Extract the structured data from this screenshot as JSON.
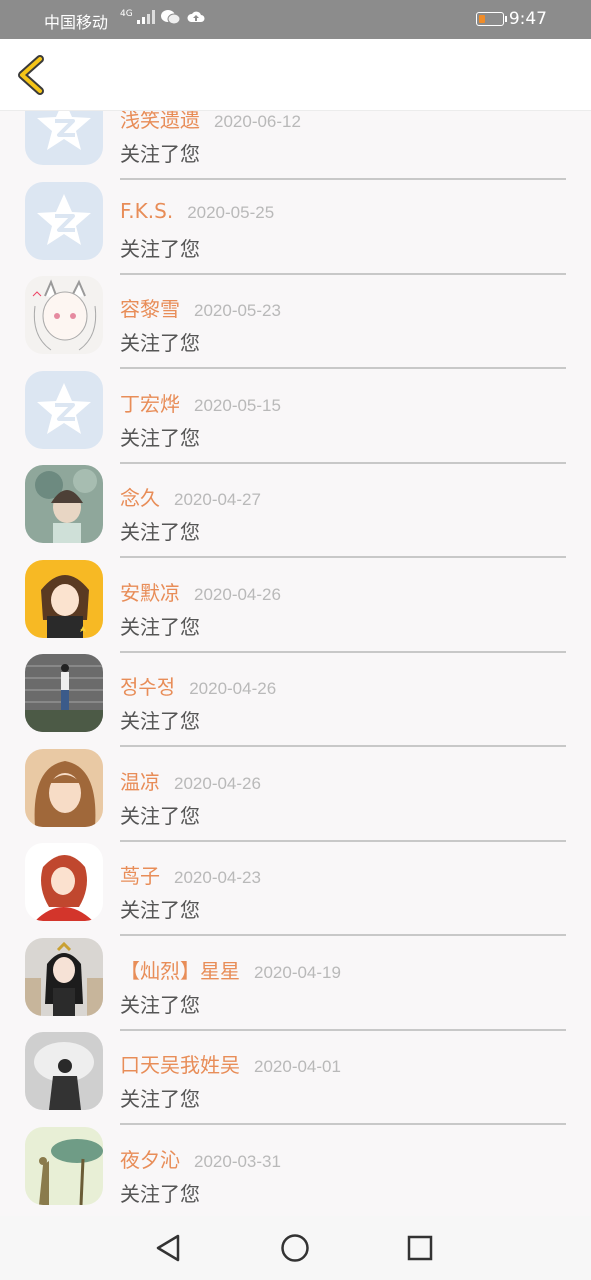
{
  "status_bar": {
    "carrier": "中国移动",
    "network": "4G",
    "time": "9:47",
    "battery_level": 0.25
  },
  "header": {
    "back_icon": "chevron-left-icon",
    "accent": "#f5c518"
  },
  "colors": {
    "name": "#e88d58",
    "date": "#b9b9b9",
    "action": "#555555"
  },
  "follows": [
    {
      "name": "浅笑遗遗",
      "date": "2020-06-12",
      "action": "关注了您",
      "avatar": "default-qzone-avatar"
    },
    {
      "name": "F.K.S.",
      "date": "2020-05-25",
      "action": "关注了您",
      "avatar": "default-qzone-avatar"
    },
    {
      "name": "容黎雪",
      "date": "2020-05-23",
      "action": "关注了您",
      "avatar": "anime-cat-girl-avatar"
    },
    {
      "name": "丁宏烨",
      "date": "2020-05-15",
      "action": "关注了您",
      "avatar": "default-qzone-avatar"
    },
    {
      "name": "念久",
      "date": "2020-04-27",
      "action": "关注了您",
      "avatar": "painted-girl-avatar"
    },
    {
      "name": "安默凉",
      "date": "2020-04-26",
      "action": "关注了您",
      "avatar": "anime-girl-yellow-avatar"
    },
    {
      "name": "정수정",
      "date": "2020-04-26",
      "action": "关注了您",
      "avatar": "photo-girl-wall-avatar"
    },
    {
      "name": "温凉",
      "date": "2020-04-26",
      "action": "关注了您",
      "avatar": "photo-girl-selfie-avatar"
    },
    {
      "name": "茑子",
      "date": "2020-04-23",
      "action": "关注了您",
      "avatar": "anime-red-hair-avatar"
    },
    {
      "name": "【灿烈】星星",
      "date": "2020-04-19",
      "action": "关注了您",
      "avatar": "doll-girl-avatar"
    },
    {
      "name": "口天吴我姓吴",
      "date": "2020-04-01",
      "action": "关注了您",
      "avatar": "photo-man-back-avatar"
    },
    {
      "name": "夜夕沁",
      "date": "2020-03-31",
      "action": "关注了您",
      "avatar": "illustration-giraffe-avatar"
    }
  ],
  "nav_bar": {
    "back_icon": "triangle-back-icon",
    "home_icon": "circle-home-icon",
    "recents_icon": "square-recents-icon"
  }
}
